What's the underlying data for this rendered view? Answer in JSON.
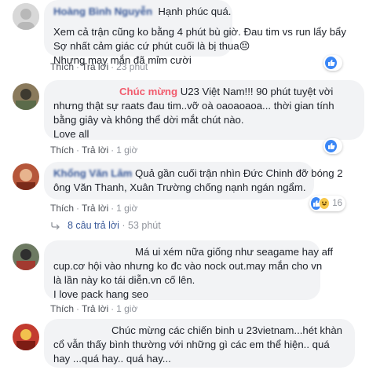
{
  "comments": [
    {
      "name": "Hoàng Bình Nguyễn",
      "lines": [
        "Hạnh phúc quá.",
        "Xem cả trận cũng ko bằng 4 phút bù giờ. Đau tim vs run lẩy bẩy",
        "Sợ nhất cảm giác cứ phút cuối là bị thua😔",
        "Nhưng may mắn đã mỉm cười"
      ],
      "like_label": "Thích",
      "reply_label": "Trả lời",
      "time": "23 phút",
      "reaction_count": ""
    },
    {
      "name": "",
      "highlight": "Chúc mừng",
      "lines": [
        "U23 Việt Nam!!! 90 phút tuyệt vời",
        "nhưng thật sự raats đau tim..vỡ oà oaoaoaoa... thời gian tính",
        "bằng giây và không thể dời mắt chút nào.",
        "Love all"
      ],
      "like_label": "Thích",
      "reply_label": "Trả lời",
      "time": "1 giờ",
      "reaction_count": ""
    },
    {
      "name": "Khổng Văn Lâm",
      "lines": [
        "Quả gần cuối trận nhìn Đức Chinh đỡ bóng 2",
        "ông Văn Thanh, Xuân Trường chống nạnh ngán ngẩm."
      ],
      "like_label": "Thích",
      "reply_label": "Trả lời",
      "time": "1 giờ",
      "reaction_count": "16",
      "replies_label": "8 câu trả lời",
      "replies_time": "53 phút"
    },
    {
      "name": "",
      "lines": [
        "Má ui xém nữa giống như seagame hay aff",
        "cup.cơ hội vào nhưng ko đc vào nock out.may mắn cho vn",
        "là lần này ko tái diễn.vn cố lên.",
        "I love pack hang seo"
      ],
      "like_label": "Thích",
      "reply_label": "Trả lời",
      "time": "1 giờ",
      "reaction_count": ""
    },
    {
      "name": "",
      "lines": [
        "Chúc mừng các chiến binh u 23vietnam...hét khàn",
        "cổ vẫn thấy bình thường với những gì các em thể hiện.. quá",
        "hay ...quá hay.. quá hay..."
      ]
    }
  ],
  "colors": {
    "link": "#385898",
    "bubble": "#f2f3f5",
    "highlight": "#f15a6c",
    "muted": "#90949c"
  },
  "icons": [
    "like-icon",
    "haha-icon",
    "reply-arrow-icon"
  ]
}
